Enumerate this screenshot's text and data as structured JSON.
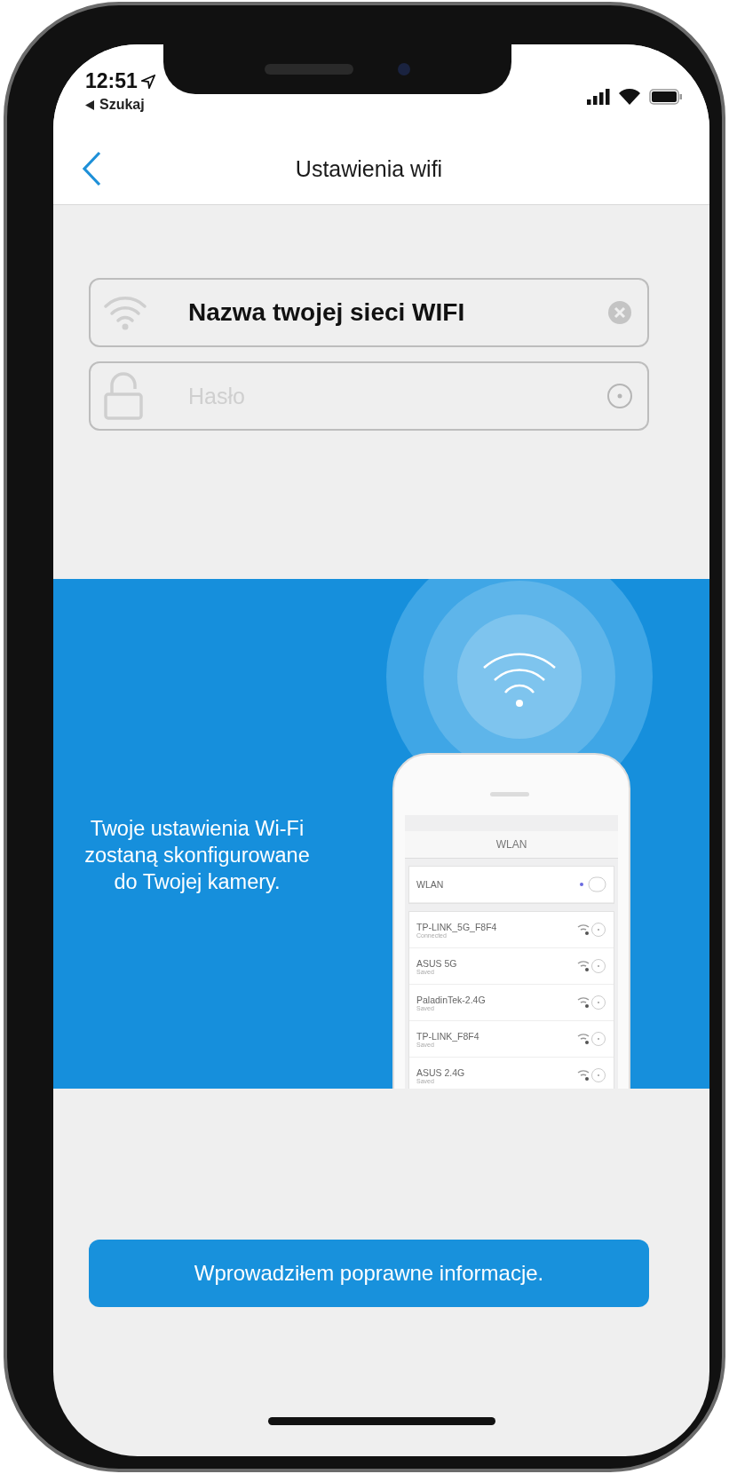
{
  "status_bar": {
    "time": "12:51",
    "back_label": "Szukaj"
  },
  "nav": {
    "title": "Ustawienia wifi"
  },
  "fields": [
    {
      "kind": "ssid",
      "value": "Nazwa twojej sieci WIFI"
    },
    {
      "kind": "password",
      "placeholder": "Hasło"
    }
  ],
  "banner": {
    "text": "Twoje ustawienia Wi-Fi zostaną skonfigurowane do Twojej kamery.",
    "illustration": {
      "title": "WLAN",
      "toggle_label": "WLAN",
      "networks": [
        {
          "name": "TP-LINK_5G_F8F4",
          "status": "Connected"
        },
        {
          "name": "ASUS 5G",
          "status": "Saved"
        },
        {
          "name": "PaladinTek-2.4G",
          "status": "Saved"
        },
        {
          "name": "TP-LINK_F8F4",
          "status": "Saved"
        },
        {
          "name": "ASUS 2.4G",
          "status": "Saved"
        }
      ]
    }
  },
  "confirm_button": "Wprowadziłem poprawne informacje."
}
